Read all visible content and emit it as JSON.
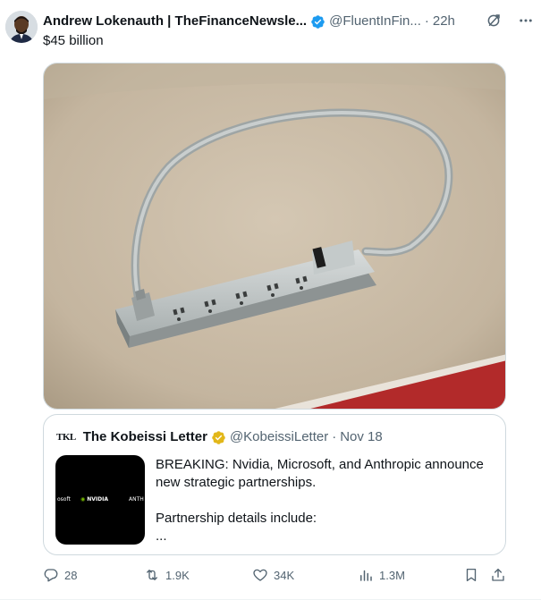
{
  "tweet": {
    "author_name": "Andrew Lokenauth | TheFinanceNewsle...",
    "handle": "@FluentInFin...",
    "separator": "·",
    "time": "22h",
    "text": "$45 billion",
    "icons": [
      "verified-badge-icon",
      "grok-icon",
      "more-icon"
    ]
  },
  "quote": {
    "logo_text": "TKL",
    "author_name": "The Kobeissi Letter",
    "handle": "@KobeissiLetter",
    "separator": "·",
    "date": "Nov 18",
    "thumbnail": {
      "left_text": "osoft",
      "center_text": "NVIDIA",
      "right_text": "ANTH"
    },
    "lines": [
      "BREAKING: Nvidia, Microsoft, and Anthropic announce new strategic partnerships.",
      "Partnership details include:",
      "..."
    ]
  },
  "actions": {
    "replies": "28",
    "reposts": "1.9K",
    "likes": "34K",
    "views": "1.3M"
  },
  "colors": {
    "accent": "#1d9bf0",
    "gold_badge": "#e2b719",
    "secondary_text": "#536471",
    "border": "#cfd9de"
  }
}
